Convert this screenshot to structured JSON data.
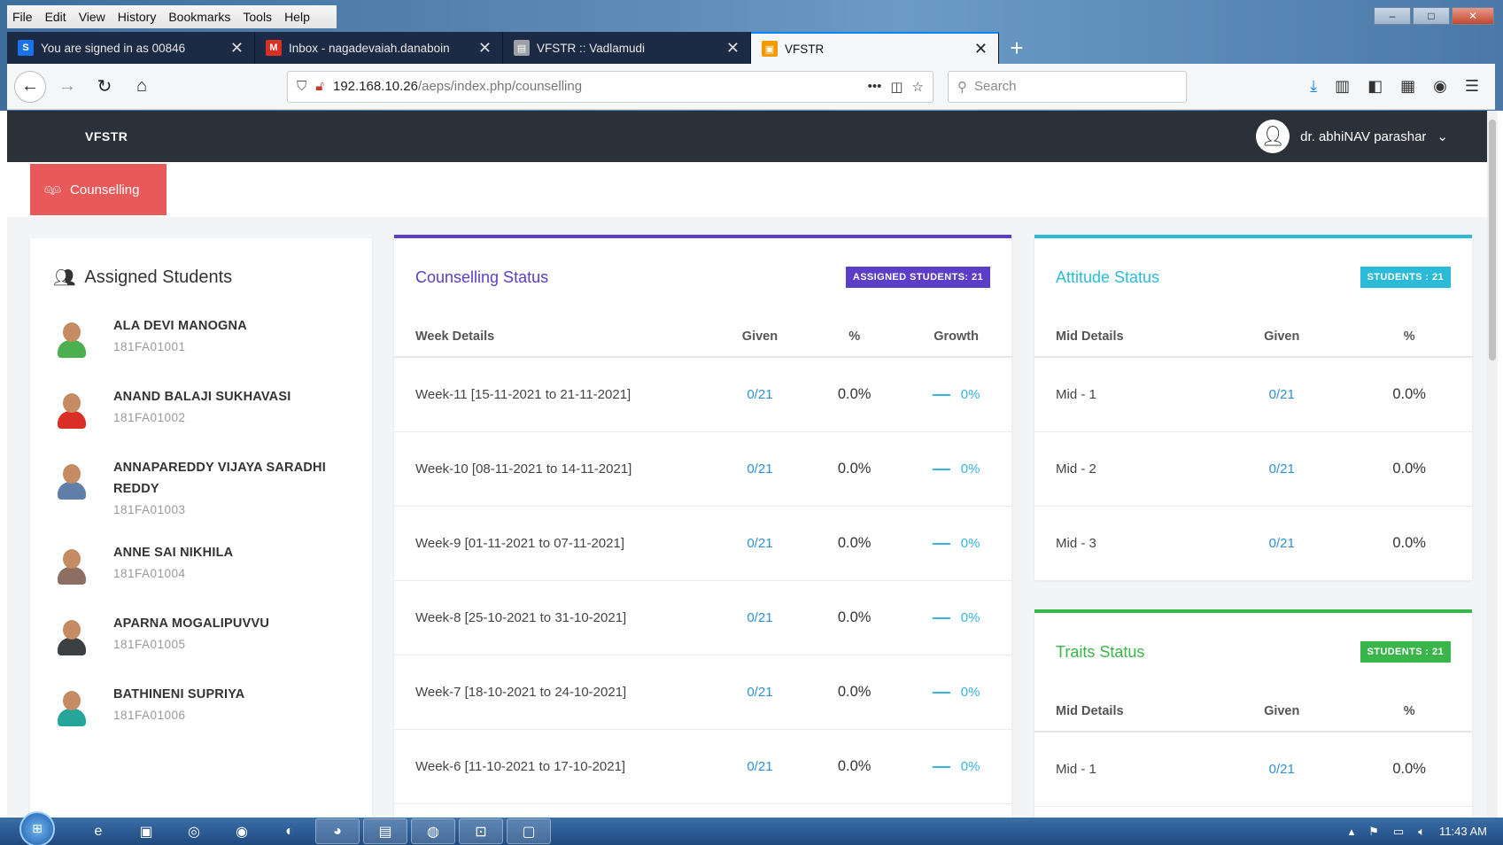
{
  "browser": {
    "menu": [
      "File",
      "Edit",
      "View",
      "History",
      "Bookmarks",
      "Tools",
      "Help"
    ],
    "tabs": [
      {
        "label": "You are signed in as 00846",
        "favicon": "S",
        "color": "#1a73e8",
        "active": false
      },
      {
        "label": "Inbox - nagadevaiah.danaboin",
        "favicon": "M",
        "color": "#d93025",
        "active": false
      },
      {
        "label": "VFSTR :: Vadlamudi",
        "favicon": "▤",
        "color": "#9aa0a6",
        "active": false
      },
      {
        "label": "VFSTR",
        "favicon": "▣",
        "color": "#f29900",
        "active": true
      }
    ],
    "url_host": "192.168.10.26",
    "url_path": "/aeps/index.php/counselling",
    "search_placeholder": "Search"
  },
  "app": {
    "brand": "VFSTR",
    "user_name": "dr. abhiNAV parashar"
  },
  "page_tab": "Counselling",
  "students": {
    "title": "Assigned Students",
    "items": [
      {
        "name": "ALA DEVI MANOGNA",
        "id": "181FA01001",
        "shirt": "#4caf50"
      },
      {
        "name": "ANAND BALAJI SUKHAVASI",
        "id": "181FA01002",
        "shirt": "#d93025"
      },
      {
        "name": "ANNAPAREDDY VIJAYA SARADHI REDDY",
        "id": "181FA01003",
        "shirt": "#5f7fa8"
      },
      {
        "name": "ANNE SAI NIKHILA",
        "id": "181FA01004",
        "shirt": "#8d6e63"
      },
      {
        "name": "APARNA MOGALIPUVVU",
        "id": "181FA01005",
        "shirt": "#3c4043"
      },
      {
        "name": "BATHINENI SUPRIYA",
        "id": "181FA01006",
        "shirt": "#26a69a"
      }
    ]
  },
  "counselling": {
    "title": "Counselling Status",
    "badge": "ASSIGNED STUDENTS: 21",
    "color": "#5a3ec8",
    "headers": [
      "Week Details",
      "Given",
      "%",
      "Growth"
    ],
    "rows": [
      {
        "week": "Week-11 [15-11-2021 to 21-11-2021]",
        "given": "0/21",
        "pct": "0.0%",
        "growth": "0%"
      },
      {
        "week": "Week-10 [08-11-2021 to 14-11-2021]",
        "given": "0/21",
        "pct": "0.0%",
        "growth": "0%"
      },
      {
        "week": "Week-9 [01-11-2021 to 07-11-2021]",
        "given": "0/21",
        "pct": "0.0%",
        "growth": "0%"
      },
      {
        "week": "Week-8 [25-10-2021 to 31-10-2021]",
        "given": "0/21",
        "pct": "0.0%",
        "growth": "0%"
      },
      {
        "week": "Week-7 [18-10-2021 to 24-10-2021]",
        "given": "0/21",
        "pct": "0.0%",
        "growth": "0%"
      },
      {
        "week": "Week-6 [11-10-2021 to 17-10-2021]",
        "given": "0/21",
        "pct": "0.0%",
        "growth": "0%"
      }
    ]
  },
  "attitude": {
    "title": "Attitude Status",
    "badge": "STUDENTS : 21",
    "color": "#2bbbd8",
    "headers": [
      "Mid Details",
      "Given",
      "%"
    ],
    "rows": [
      {
        "mid": "Mid - 1",
        "given": "0/21",
        "pct": "0.0%"
      },
      {
        "mid": "Mid - 2",
        "given": "0/21",
        "pct": "0.0%"
      },
      {
        "mid": "Mid - 3",
        "given": "0/21",
        "pct": "0.0%"
      }
    ]
  },
  "traits": {
    "title": "Traits Status",
    "badge": "STUDENTS : 21",
    "color": "#3ab54a",
    "headers": [
      "Mid Details",
      "Given",
      "%"
    ],
    "rows": [
      {
        "mid": "Mid - 1",
        "given": "0/21",
        "pct": "0.0%"
      }
    ]
  },
  "taskbar": {
    "clock": "11:43 AM"
  }
}
